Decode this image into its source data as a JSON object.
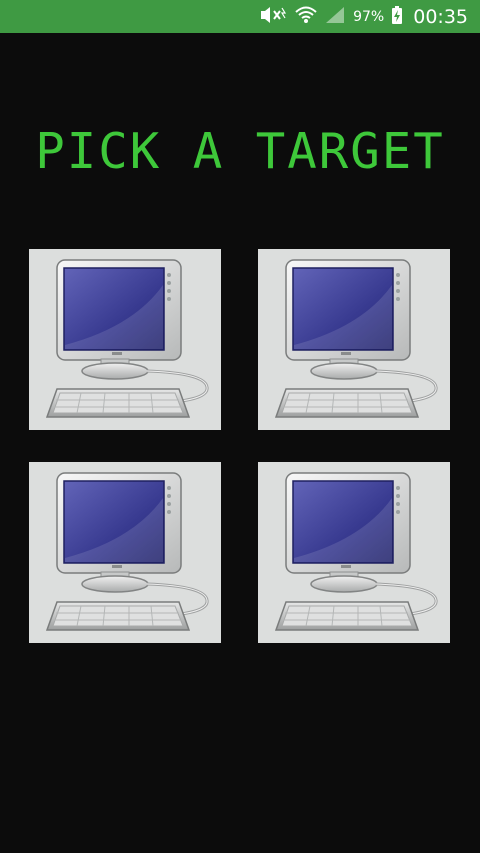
{
  "status_bar": {
    "battery_percent": "97%",
    "time": "00:35",
    "icons": [
      "mute-icon",
      "wifi-icon",
      "signal-icon",
      "battery-charging-icon"
    ]
  },
  "title": "PICK A TARGET",
  "colors": {
    "status_bar": "#3f9a43",
    "background": "#0c0c0c",
    "title": "#3ec83a",
    "tile_background": "#dcdedd"
  },
  "targets": [
    {
      "icon": "computer-icon"
    },
    {
      "icon": "computer-icon"
    },
    {
      "icon": "computer-icon"
    },
    {
      "icon": "computer-icon"
    }
  ]
}
